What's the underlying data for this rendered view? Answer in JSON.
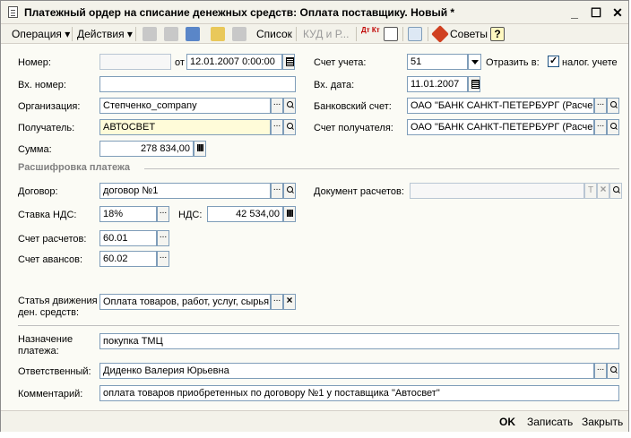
{
  "window": {
    "title": "Платежный ордер на списание денежных средств: Оплата поставщику. Новый *",
    "minimize": "_",
    "maximize": "☐",
    "close": "✕"
  },
  "toolbar": {
    "operation": "Операция ▾",
    "actions": "Действия ▾",
    "list": "Список",
    "kudir": "КУД и Р...",
    "advice": "Советы",
    "help": "?",
    "dtkt": "Дт Кт"
  },
  "form": {
    "number_label": "Номер:",
    "number_value": "",
    "from_label": "от",
    "date_value": "12.01.2007  0:00:00",
    "account_label": "Счет учета:",
    "account_value": "51",
    "reflect_label": "Отразить в:",
    "tax_label": "налог. учете",
    "tax_checked": true,
    "in_number_label": "Вх. номер:",
    "in_number_value": "",
    "in_date_label": "Вх. дата:",
    "in_date_value": "11.01.2007",
    "org_label": "Организация:",
    "org_value": "Степченко_company",
    "bank_account_label": "Банковский счет:",
    "bank_account_value": "ОАО \"БАНК САНКТ-ПЕТЕРБУРГ (Расче",
    "recipient_label": "Получатель:",
    "recipient_value": "АВТОСВЕТ",
    "recipient_account_label": "Счет получателя:",
    "recipient_account_value": "ОАО \"БАНК САНКТ-ПЕТЕРБУРГ (Расче",
    "sum_label": "Сумма:",
    "sum_value": "278 834,00"
  },
  "decode": {
    "section_title": "Расшифровка платежа",
    "contract_label": "Договор:",
    "contract_value": "договор №1",
    "doc_label": "Документ расчетов:",
    "doc_value": "",
    "vat_rate_label": "Ставка НДС:",
    "vat_rate_value": "18%",
    "vat_label": "НДС:",
    "vat_value": "42 534,00",
    "settle_label": "Счет расчетов:",
    "settle_value": "60.01",
    "advance_label": "Счет авансов:",
    "advance_value": "60.02",
    "cashflow_label_1": "Статья движения",
    "cashflow_label_2": "ден. средств:",
    "cashflow_value": "Оплата товаров, работ, услуг, сырья"
  },
  "bottom": {
    "purpose_label_1": "Назначение",
    "purpose_label_2": "платежа:",
    "purpose_value": "покупка ТМЦ",
    "responsible_label": "Ответственный:",
    "responsible_value": "Диденко Валерия Юрьевна",
    "comment_label": "Комментарий:",
    "comment_value": "оплата товаров приобретенных по договору №1 у поставщика \"Автосвет\""
  },
  "footer": {
    "ok": "OK",
    "save": "Записать",
    "close": "Закрыть"
  }
}
